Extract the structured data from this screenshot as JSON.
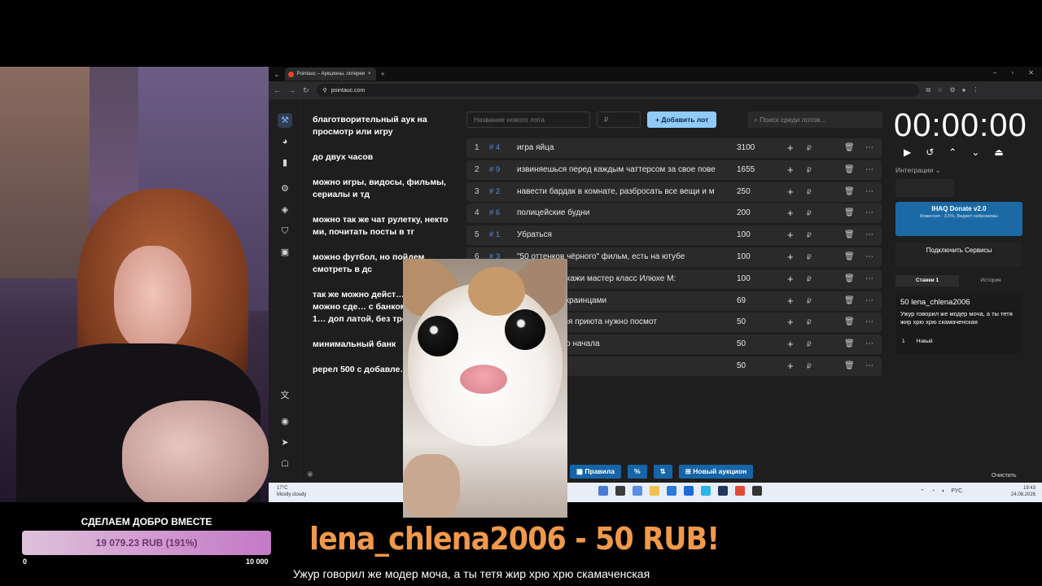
{
  "browser": {
    "tab_title": "Pointauc – Аукционы, лотереи",
    "url": "pointauc.com"
  },
  "sidebar": {
    "icons": [
      "gavel-icon",
      "wheel-icon",
      "chart-icon",
      "gear-icon",
      "layers-icon",
      "shield-icon",
      "media-icon",
      "translate-icon",
      "github-icon",
      "telegram-icon",
      "bot-icon"
    ]
  },
  "notes": [
    "благотворительный аук на просмотр или игру",
    "до  двух часов",
    "можно игры, видосы, фильмы, сериалы и тд",
    "можно так же чат рулетку, некто ми, почитать посты в тг",
    "можно футбол, но пойдем смотреть в дс",
    "так же можно дейст… которое можно сде… с банком не более 1… доп латой, без треш… часов",
    "минимальный банк",
    "ререл 500 с добавле… дальше x2"
  ],
  "controls": {
    "lot_name_placeholder": "Название нового лота",
    "amount_placeholder": "₽",
    "add_lot_label": "Добавить лот",
    "search_placeholder": "Поиск среди лотов..."
  },
  "lots": [
    {
      "n": "1",
      "id": "# 4",
      "name": "игра яйца",
      "amount": "3100"
    },
    {
      "n": "2",
      "id": "# 9",
      "name": "извиняешься перед каждым чаттерсом за свое пове",
      "amount": "1655"
    },
    {
      "n": "3",
      "id": "# 2",
      "name": "навести бардак в комнате, разбросать все вещи и м",
      "amount": "250"
    },
    {
      "n": "4",
      "id": "# 6",
      "name": "полицейские будни",
      "amount": "200"
    },
    {
      "n": "5",
      "id": "# 1",
      "name": "Убраться",
      "amount": "100"
    },
    {
      "n": "6",
      "id": "# 3",
      "name": "\"50 оттенков чёрного\" фильм, есть на ютубе",
      "amount": "100"
    },
    {
      "n": "7",
      "id": "",
      "name": "...грессер, покажи мастер класс Илюхе М:",
      "amount": "100"
    },
    {
      "n": "8",
      "id": "",
      "name": "...рулетки с украинцами",
      "amount": "69"
    },
    {
      "n": "9",
      "id": "",
      "name": "...о посещения приюта нужно посмот",
      "amount": "50"
    },
    {
      "n": "10",
      "id": "",
      "name": "...гал с самого начала",
      "amount": "50"
    },
    {
      "n": "11",
      "id": "",
      "name": "",
      "amount": "50"
    }
  ],
  "timer": {
    "value": "00:00:00",
    "integrations_label": "Интеграции",
    "donate_title": "IHAQ Donate v2.0",
    "donate_sub": "Комиссия - 3,5%, Виджет нейромемы",
    "connect_label": "Подключить Сервисы",
    "tab_bids": "Ставки",
    "tab_bids_count": "1",
    "tab_history": "История"
  },
  "bid": {
    "user": "50 lena_chlena2006",
    "message": "Ужур говорил же модер моча, а ты тетя жир хрю хрю скамаченская",
    "index": "1",
    "status": "Новый"
  },
  "bottom_bar": {
    "rules": "Правила",
    "percent": "%",
    "new_auction": "Новый аукцион",
    "clear": "Очистить"
  },
  "taskbar": {
    "weather_temp": "17°C",
    "weather_desc": "Mostly cloudy",
    "lang": "РУС",
    "time": "19:43",
    "date": "24.08.2026"
  },
  "goal": {
    "title": "СДЕЛАЕМ ДОБРО ВМЕСТЕ",
    "progress_text": "19 079.23 RUB (191%)",
    "progress_percent": 191,
    "min": "0",
    "max": "10 000"
  },
  "alert": {
    "headline": "lena_chlena2006 - 50 RUB!",
    "message": "Ужур говорил же модер моча, а ты тетя жир хрю хрю скамаченская"
  },
  "colors": {
    "accent": "#90caf9",
    "alert": "#f0994a",
    "id": "#5a8bd6"
  }
}
